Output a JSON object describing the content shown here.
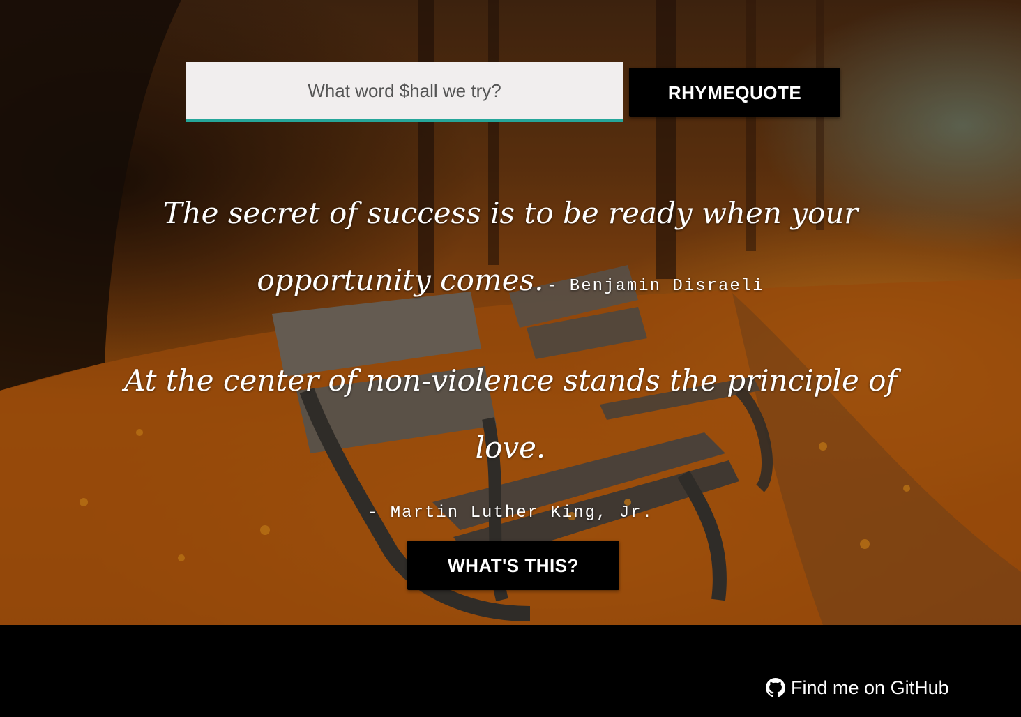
{
  "search": {
    "placeholder": "What word $hall we try?"
  },
  "buttons": {
    "rhyme_label": "RHYMEQUOTE",
    "whats_label": "WHAT'S THIS?"
  },
  "quotes": [
    {
      "text": "The secret of success is to be ready when your opportunity comes.",
      "author": "- Benjamin Disraeli"
    },
    {
      "text": "At the center of non-violence stands the principle of love.",
      "author": "- Martin Luther King, Jr."
    }
  ],
  "footer": {
    "github_label": "Find me on GitHub",
    "github_icon": "github-icon"
  },
  "colors": {
    "input_underline": "#26a69a",
    "button_bg": "#000000",
    "footer_bg": "#000000"
  }
}
